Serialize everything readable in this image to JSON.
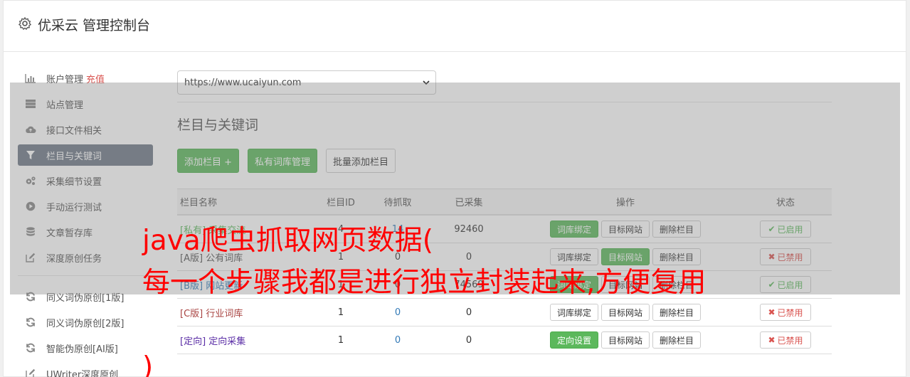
{
  "header": {
    "title": "优采云 管理控制台"
  },
  "sidebar": {
    "items": [
      {
        "label": "账户管理",
        "badge": "充值",
        "icon": "bar-chart-icon"
      },
      {
        "label": "站点管理",
        "icon": "server-icon"
      },
      {
        "label": "接口文件相关",
        "icon": "cloud-upload-icon"
      },
      {
        "label": "栏目与关键词",
        "icon": "filter-icon",
        "active": true
      },
      {
        "label": "采集细节设置",
        "icon": "cogs-icon"
      },
      {
        "label": "手动运行测试",
        "icon": "play-icon"
      },
      {
        "label": "文章暂存库",
        "icon": "database-icon"
      },
      {
        "label": "深度原创任务",
        "icon": "edit-icon"
      },
      {
        "label": "同义词伪原创[1版]",
        "icon": "refresh-icon"
      },
      {
        "label": "同义词伪原创[2版]",
        "icon": "refresh-icon"
      },
      {
        "label": "智能伪原创[AI版]",
        "icon": "refresh-icon"
      },
      {
        "label": "UWriter深度原创",
        "icon": "edit-icon"
      }
    ]
  },
  "main": {
    "site_select_value": "https://www.ucaiyun.com",
    "section_title": "栏目与关键词",
    "buttons": {
      "add": "添加栏目 +",
      "private_lib": "私有词库管理",
      "batch_add": "批量添加栏目"
    },
    "table": {
      "headers": {
        "name": "栏目名称",
        "id": "栏目ID",
        "pending": "待抓取",
        "collected": "已采集",
        "ops": "操作",
        "status": "状态"
      },
      "rows": [
        {
          "tag": "[私有]",
          "name": "采集交流",
          "id": "4",
          "pending": "14",
          "collected": "92460",
          "op1": "词库绑定",
          "op2": "目标网站",
          "op3": "删除栏目",
          "status": "已启用"
        },
        {
          "tag": "[A版]",
          "name": "公有词库",
          "id": "1",
          "pending": "0",
          "collected": "0",
          "op1": "词库绑定",
          "op2": "目标网站",
          "op3": "删除栏目",
          "status": "已禁用"
        },
        {
          "tag": "[B版]",
          "name": "网站更新",
          "id": "1",
          "pending": "0",
          "collected": "74569",
          "op1": "词库绑定",
          "op2": "目标网站",
          "op3": "删除栏目",
          "status": "已启用"
        },
        {
          "tag": "[C版]",
          "name": "行业词库",
          "id": "1",
          "pending": "0",
          "collected": "0",
          "op1": "词库绑定",
          "op2": "目标网站",
          "op3": "删除栏目",
          "status": "已禁用"
        },
        {
          "tag": "[定向]",
          "name": "定向采集",
          "id": "1",
          "pending": "0",
          "collected": "0",
          "op1": "定向设置",
          "op2": "目标网站",
          "op3": "删除栏目",
          "status": "已禁用"
        }
      ]
    }
  },
  "watermark": {
    "line1": "java爬虫抓取网页数据(",
    "line2": "每一个步骤我都是进行独立封装起来,方便复用",
    "line3": ")"
  },
  "colors": {
    "green": "#5cb85c",
    "red": "#d9534f",
    "active_bg": "#707a88",
    "watermark": "#ff0000"
  }
}
